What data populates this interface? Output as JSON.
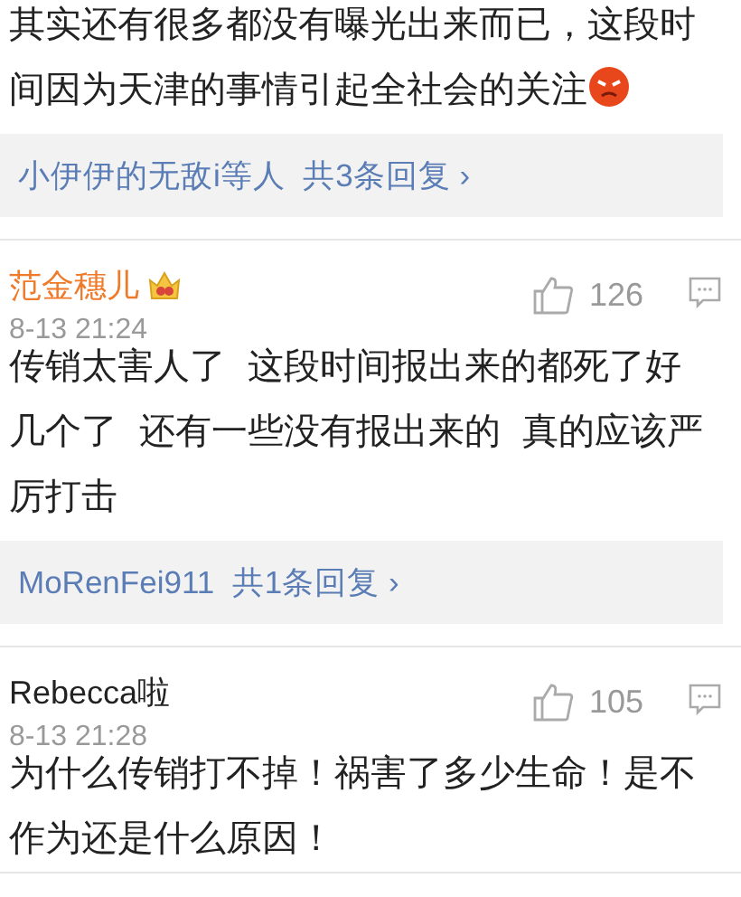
{
  "comments": [
    {
      "text": "其实还有很多都没有曝光出来而已，这段时间因为天津的事情引起全社会的关注",
      "emoji": true,
      "replies": {
        "users": "小伊伊的无敌i等人",
        "count": "共3条回复",
        "arrow": "›"
      }
    },
    {
      "author": "范金穗儿",
      "vip": true,
      "time": "8-13 21:24",
      "likes": "126",
      "text": "传销太害人了 这段时间报出来的都死了好几个了 还有一些没有报出来的 真的应该严厉打击",
      "emoji": false,
      "replies": {
        "users": "MoRenFei911",
        "count": "共1条回复",
        "arrow": "›"
      }
    },
    {
      "author": "Rebecca啦",
      "vip": false,
      "time": "8-13 21:28",
      "likes": "105",
      "text": "为什么传销打不掉！祸害了多少生命！是不作为还是什么原因！",
      "emoji": false
    }
  ]
}
